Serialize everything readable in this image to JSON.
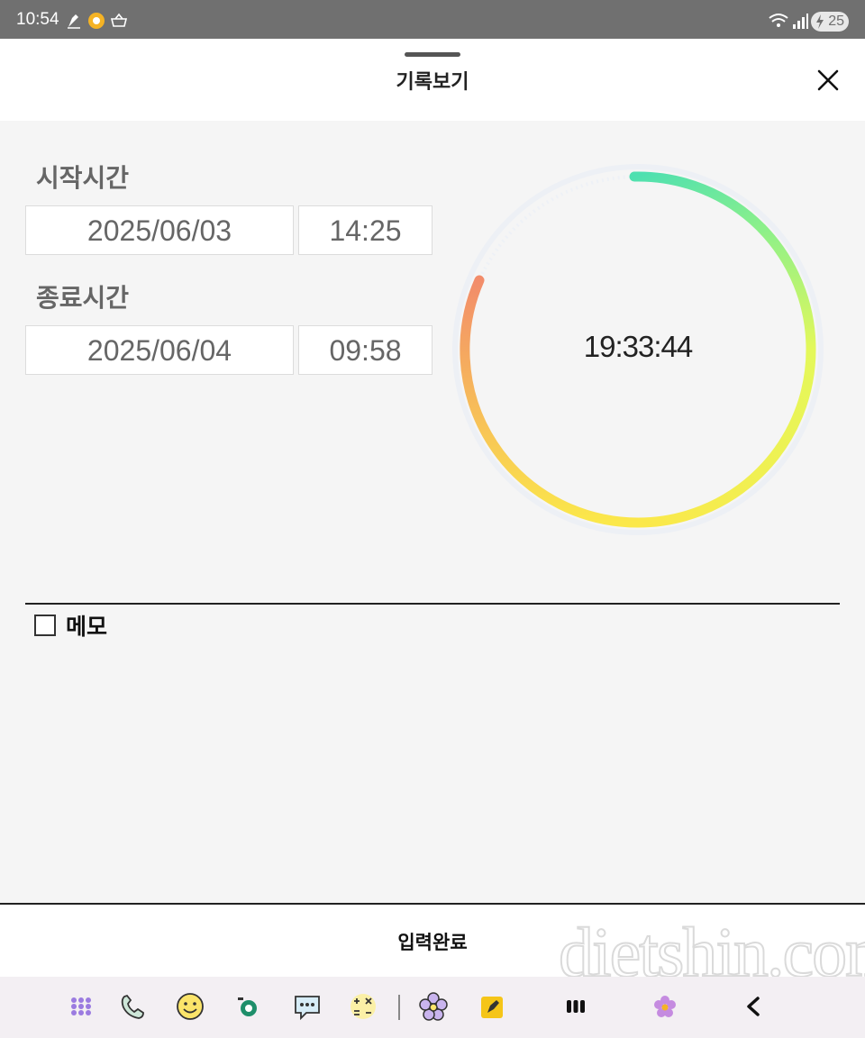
{
  "status_bar": {
    "time": "10:54",
    "battery": "25"
  },
  "header": {
    "title": "기록보기"
  },
  "start": {
    "label": "시작시간",
    "date": "2025/06/03",
    "time": "14:25"
  },
  "end": {
    "label": "종료시간",
    "date": "2025/06/04",
    "time": "09:58"
  },
  "timer": {
    "duration": "19:33:44"
  },
  "memo": {
    "label": "메모",
    "checked": false
  },
  "footer": {
    "submit_label": "입력완료",
    "watermark": "dietshin.com"
  },
  "colors": {
    "arc_start": "#f28c6a",
    "arc_mid": "#fbe84a",
    "arc_green_yellow": "#e4f85a",
    "arc_end": "#4fe0b0",
    "track": "#edf0f5"
  },
  "nav_icons": [
    "apps-icon",
    "phone-icon",
    "smiley-icon",
    "talk-icon",
    "message-icon",
    "calculator-icon",
    "flower-app-icon",
    "note-app-icon",
    "recent-apps-icon",
    "home-flower-icon",
    "back-icon"
  ]
}
